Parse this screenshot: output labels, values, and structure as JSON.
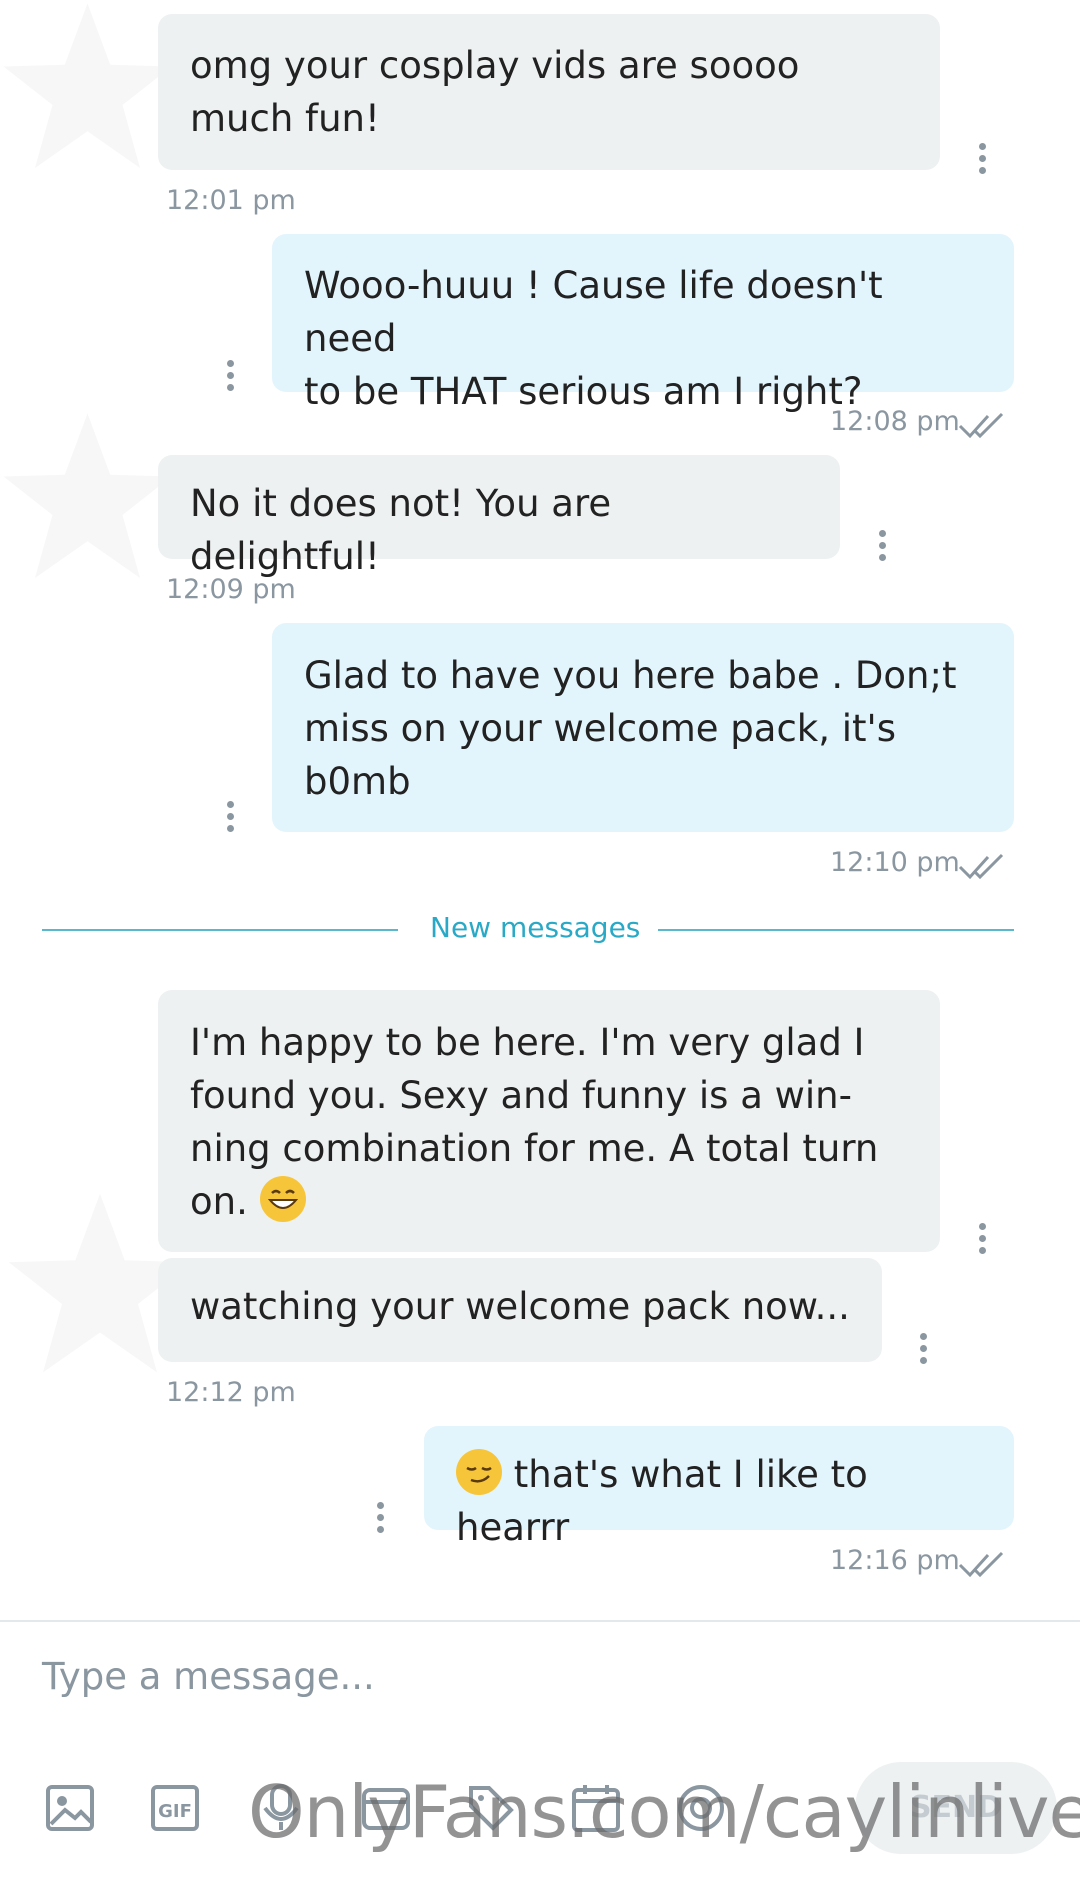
{
  "messages": [
    {
      "text": "omg your cosplay vids are soooo much fun!",
      "time": "12:01 pm"
    },
    {
      "text": "Wooo-huuu ! Cause life doesn't need to be THAT serious am I right?",
      "time": "12:08 pm"
    },
    {
      "text": "No it does not! You are delightful!",
      "time": "12:09 pm"
    },
    {
      "text": "Glad to have you here babe . Don;t miss on your welcome pack, it's b0mb",
      "time": "12:10 pm"
    },
    {
      "text": "I'm happy to be here. I'm very glad I found you. Sexy and funny is a win-ning combination for me. A total turn on.",
      "line1": "I'm happy to be here. I'm very glad I",
      "line2": "found you. Sexy and funny is a win-",
      "line3": "ning combination for me. A total turn",
      "line4": "on.",
      "emoji": "grinning-face-emoji"
    },
    {
      "text": "watching your welcome pack now...",
      "time": "12:12 pm"
    },
    {
      "text": "that's what I like to hearrr",
      "emoji": "smirking-face-emoji",
      "time": "12:16 pm"
    }
  ],
  "lines": {
    "m1a": "omg your cosplay vids are soooo",
    "m1b": "much fun!",
    "m2a": "Wooo-huuu ! Cause life doesn't need",
    "m2b": "to be THAT serious am I right?",
    "m4a": "Glad to have you here babe . Don;t",
    "m4b": "miss on your welcome pack, it's",
    "m4c": "b0mb"
  },
  "divider": "New messages",
  "composer": {
    "placeholder": "Type a message...",
    "send_label": "SEND",
    "tools": [
      "image-icon",
      "gif-icon",
      "microphone-icon",
      "vault-icon",
      "price-tag-icon",
      "schedule-icon",
      "tip-icon"
    ]
  },
  "watermark": "OnlyFans.com/caylinlive",
  "colors": {
    "incoming": "#eef1f2",
    "outgoing": "#e3f5fc",
    "accent": "#2aa9c6",
    "meta": "#8a96a0"
  }
}
